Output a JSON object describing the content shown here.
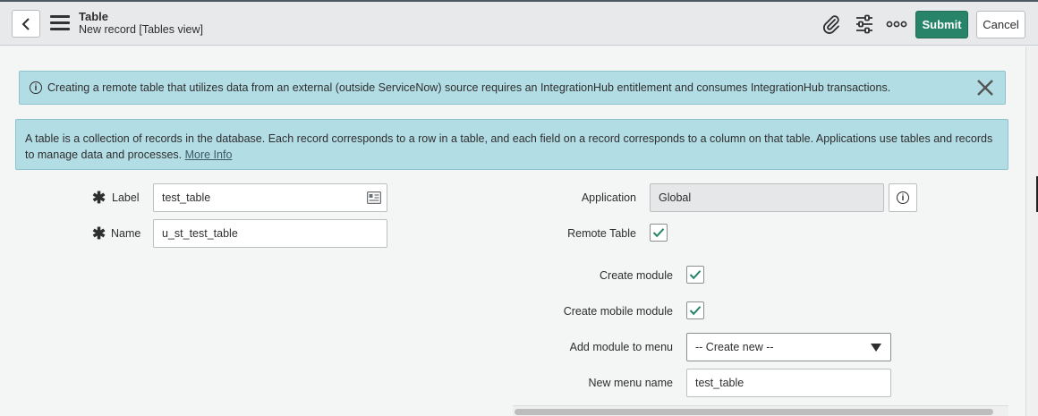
{
  "header": {
    "title": "Table",
    "subtitle": "New record [Tables view]",
    "submit_label": "Submit",
    "cancel_label": "Cancel",
    "icons": [
      "back-icon",
      "hamburger-menu-icon",
      "paperclip-icon",
      "sliders-icon",
      "more-icon"
    ]
  },
  "banners": {
    "info_text": "Creating a remote table that utilizes data from an external (outside ServiceNow) source requires an IntegrationHub entitlement and consumes IntegrationHub transactions.",
    "description": "A table is a collection of records in the database. Each record corresponds to a row in a table, and each field on a record corresponds to a column on that table. Applications use tables and records to manage data and processes.",
    "more_info_link": "More Info"
  },
  "form": {
    "label": {
      "label": "Label",
      "value": "test_table"
    },
    "name": {
      "label": "Name",
      "value": "u_st_test_table"
    },
    "application": {
      "label": "Application",
      "value": "Global"
    },
    "remote_table": {
      "label": "Remote Table",
      "checked": true
    },
    "create_module": {
      "label": "Create module",
      "checked": true
    },
    "create_mobile_module": {
      "label": "Create mobile module",
      "checked": true
    },
    "add_module_to_menu": {
      "label": "Add module to menu",
      "value": "-- Create new --"
    },
    "new_menu_name": {
      "label": "New menu name",
      "value": "test_table"
    }
  },
  "colors": {
    "primary": "#278468",
    "banner_bg": "#b3dde5",
    "check": "#278468"
  }
}
